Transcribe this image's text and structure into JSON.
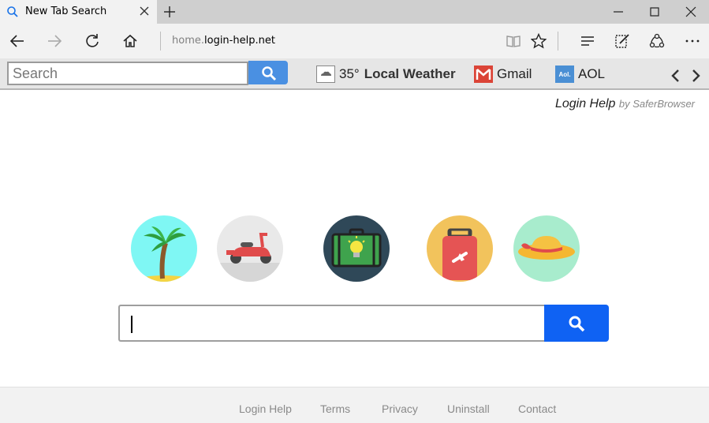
{
  "browser": {
    "tab_title": "New Tab Search",
    "url_prefix": "home.",
    "url_host": "login-help.net"
  },
  "toolbar": {
    "search_placeholder": "Search",
    "weather_temp": "35°",
    "weather_label": "Local Weather",
    "gmail_label": "Gmail",
    "aol_label": "AOL",
    "aol_icon_text": "Aol."
  },
  "brand": {
    "name": "Login Help",
    "by": "by SaferBrowser"
  },
  "circles": [
    {
      "name": "palm-tree-icon",
      "bg": "#7ff7f4"
    },
    {
      "name": "scooter-icon",
      "bg": "#e9e9e9"
    },
    {
      "name": "suitcase-idea-icon",
      "bg": "#2f4858"
    },
    {
      "name": "luggage-icon",
      "bg": "#f2c35c"
    },
    {
      "name": "sun-hat-icon",
      "bg": "#a8eccd"
    }
  ],
  "search": {
    "value": ""
  },
  "footer": {
    "links": [
      "Login Help",
      "Terms",
      "Privacy",
      "Uninstall",
      "Contact"
    ]
  },
  "colors": {
    "accent": "#0f62f3",
    "toolbar_button": "#4a90e2"
  }
}
